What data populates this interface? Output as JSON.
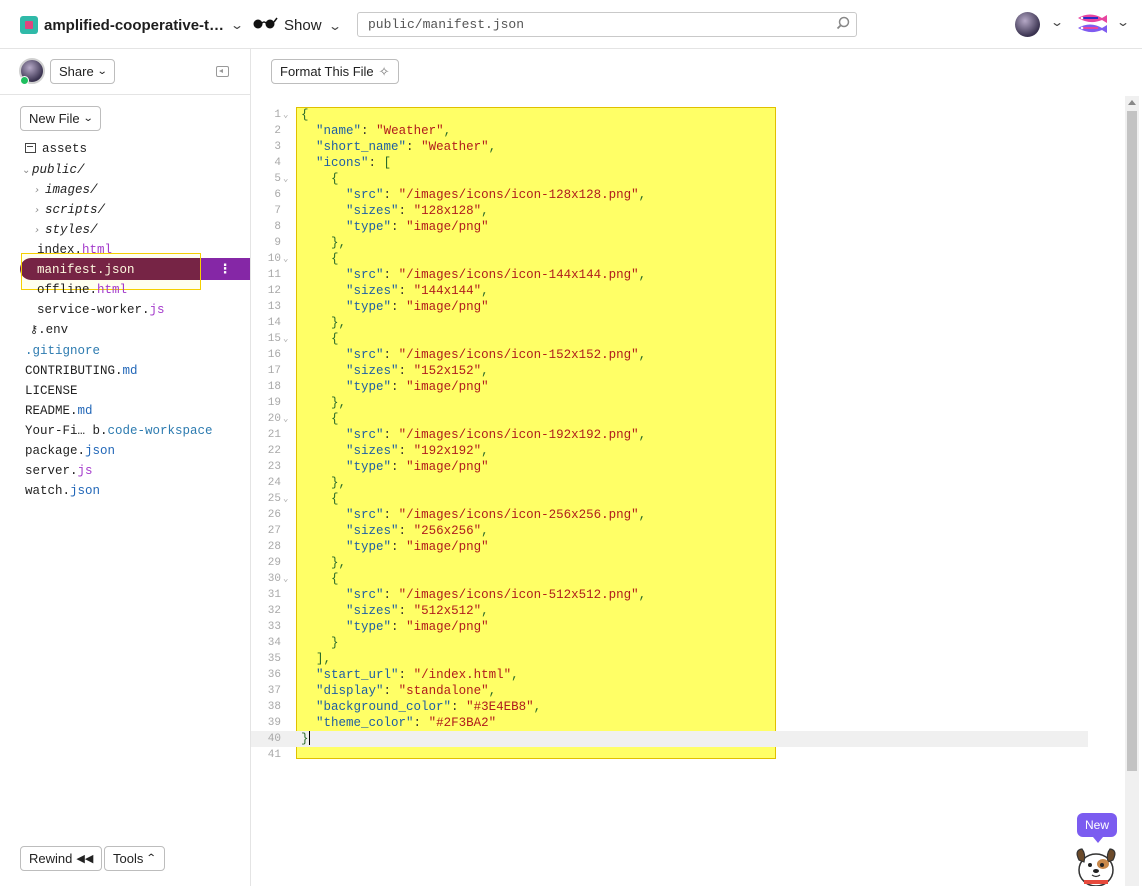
{
  "topbar": {
    "project_name": "amplified-cooperative-t…",
    "show_label": "Show",
    "search_value": "public/manifest.json"
  },
  "sidebar": {
    "share_label": "Share",
    "new_file_label": "New File",
    "rewind_label": "Rewind",
    "tools_label": "Tools",
    "selected_menu": "⋮",
    "files": [
      {
        "name": "assets",
        "ext": ""
      },
      {
        "name": "public/",
        "ext": ""
      },
      {
        "name": "images/",
        "ext": ""
      },
      {
        "name": "scripts/",
        "ext": ""
      },
      {
        "name": "styles/",
        "ext": ""
      },
      {
        "name": "index.",
        "ext": "html"
      },
      {
        "name": "manifest.json",
        "ext": ""
      },
      {
        "name": "offline.",
        "ext": "html"
      },
      {
        "name": "service-worker.",
        "ext": "js"
      },
      {
        "name": ".env",
        "ext": ""
      },
      {
        "name": ".gitignore",
        "ext": ""
      },
      {
        "name": "CONTRIBUTING.",
        "ext": "md"
      },
      {
        "name": "LICENSE",
        "ext": ""
      },
      {
        "name": "README.",
        "ext": "md"
      },
      {
        "name": "Your-Fi… b.",
        "ext": "code-workspace"
      },
      {
        "name": "package.",
        "ext": "json"
      },
      {
        "name": "server.",
        "ext": "js"
      },
      {
        "name": "watch.",
        "ext": "json"
      }
    ]
  },
  "editor": {
    "format_label": "Format This File",
    "lines": [
      "{",
      "  \"name\": \"Weather\",",
      "  \"short_name\": \"Weather\",",
      "  \"icons\": [",
      "    {",
      "      \"src\": \"/images/icons/icon-128x128.png\",",
      "      \"sizes\": \"128x128\",",
      "      \"type\": \"image/png\"",
      "    },",
      "    {",
      "      \"src\": \"/images/icons/icon-144x144.png\",",
      "      \"sizes\": \"144x144\",",
      "      \"type\": \"image/png\"",
      "    },",
      "    {",
      "      \"src\": \"/images/icons/icon-152x152.png\",",
      "      \"sizes\": \"152x152\",",
      "      \"type\": \"image/png\"",
      "    },",
      "    {",
      "      \"src\": \"/images/icons/icon-192x192.png\",",
      "      \"sizes\": \"192x192\",",
      "      \"type\": \"image/png\"",
      "    },",
      "    {",
      "      \"src\": \"/images/icons/icon-256x256.png\",",
      "      \"sizes\": \"256x256\",",
      "      \"type\": \"image/png\"",
      "    },",
      "    {",
      "      \"src\": \"/images/icons/icon-512x512.png\",",
      "      \"sizes\": \"512x512\",",
      "      \"type\": \"image/png\"",
      "    }",
      "  ],",
      "  \"start_url\": \"/index.html\",",
      "  \"display\": \"standalone\",",
      "  \"background_color\": \"#3E4EB8\",",
      "  \"theme_color\": \"#2F3BA2\"",
      "}",
      ""
    ],
    "fold_lines": [
      1,
      5,
      10,
      15,
      20,
      25,
      30
    ],
    "active_line": 40
  },
  "mascot": {
    "new_label": "New"
  },
  "colors": {
    "selected_file_bg": "#6b1247",
    "selected_menu_bg": "#8527a6",
    "highlight_yellow": "#ffff66",
    "new_badge": "#7b5cf0"
  }
}
